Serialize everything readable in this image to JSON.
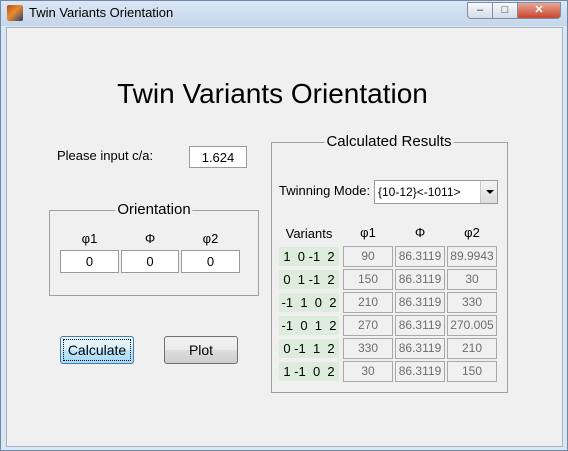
{
  "window": {
    "title": "Twin Variants Orientation",
    "controls": {
      "minimize": "–",
      "maximize": "□",
      "close": "✕"
    }
  },
  "main_title": "Twin Variants Orientation",
  "ca_input": {
    "label": "Please input c/a:",
    "value": "1.624"
  },
  "orientation": {
    "title": "Orientation",
    "headers": [
      "φ1",
      "Φ",
      "φ2"
    ],
    "values": [
      "0",
      "0",
      "0"
    ]
  },
  "buttons": {
    "calculate": "Calculate",
    "plot": "Plot"
  },
  "results": {
    "title": "Calculated Results",
    "twinning_mode_label": "Twinning Mode:",
    "twinning_mode_value": "{10-12}<-1011>",
    "headers": [
      "Variants",
      "φ1",
      "Φ",
      "φ2"
    ],
    "rows": [
      {
        "variant": "1  0 -1  2",
        "phi1": "90",
        "Phi": "86.3119",
        "phi2": "89.9943"
      },
      {
        "variant": "0  1 -1  2",
        "phi1": "150",
        "Phi": "86.3119",
        "phi2": "30"
      },
      {
        "variant": "-1  1  0  2",
        "phi1": "210",
        "Phi": "86.3119",
        "phi2": "330"
      },
      {
        "variant": "-1  0  1  2",
        "phi1": "270",
        "Phi": "86.3119",
        "phi2": "270.005"
      },
      {
        "variant": "0 -1  1  2",
        "phi1": "330",
        "Phi": "86.3119",
        "phi2": "210"
      },
      {
        "variant": "1 -1  0  2",
        "phi1": "30",
        "Phi": "86.3119",
        "phi2": "150"
      }
    ]
  },
  "colors": {
    "variant_bg": "#ddecdd",
    "focus_button": "#bee6fd",
    "window_bg": "#f0f0f0"
  }
}
